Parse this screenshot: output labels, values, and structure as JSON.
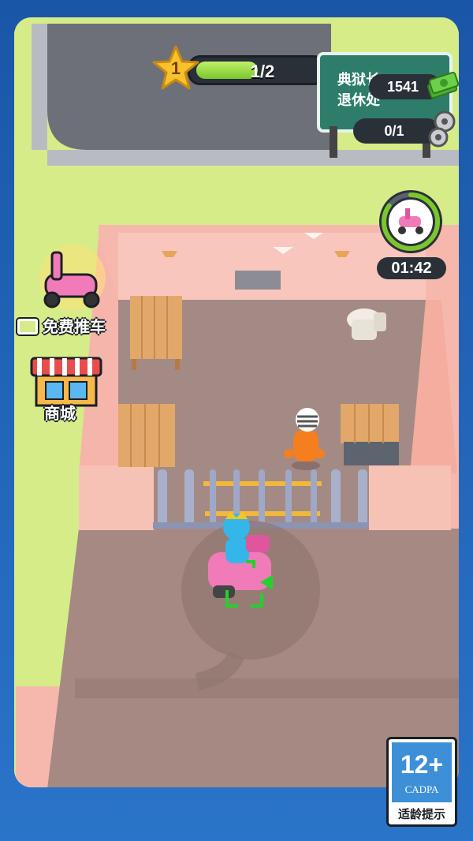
{
  "hud": {
    "level": "1",
    "progress_text": "1/2",
    "progress_fraction": 0.5,
    "money": "1541",
    "parts": "0/1",
    "timer": "01:42",
    "timer_fraction": 0.85
  },
  "sign": {
    "text": "典狱长\n退休处"
  },
  "side_buttons": {
    "free_car_label": "免费推车",
    "shop_label": "商城"
  },
  "age_rating": {
    "number": "12+",
    "org": "CADPA",
    "hint": "适龄提示"
  },
  "colors": {
    "accent_green": "#7cc62d",
    "wall_pink": "#f2a9a0",
    "floor": "#a58a83",
    "hud_dark": "#2a3038"
  }
}
